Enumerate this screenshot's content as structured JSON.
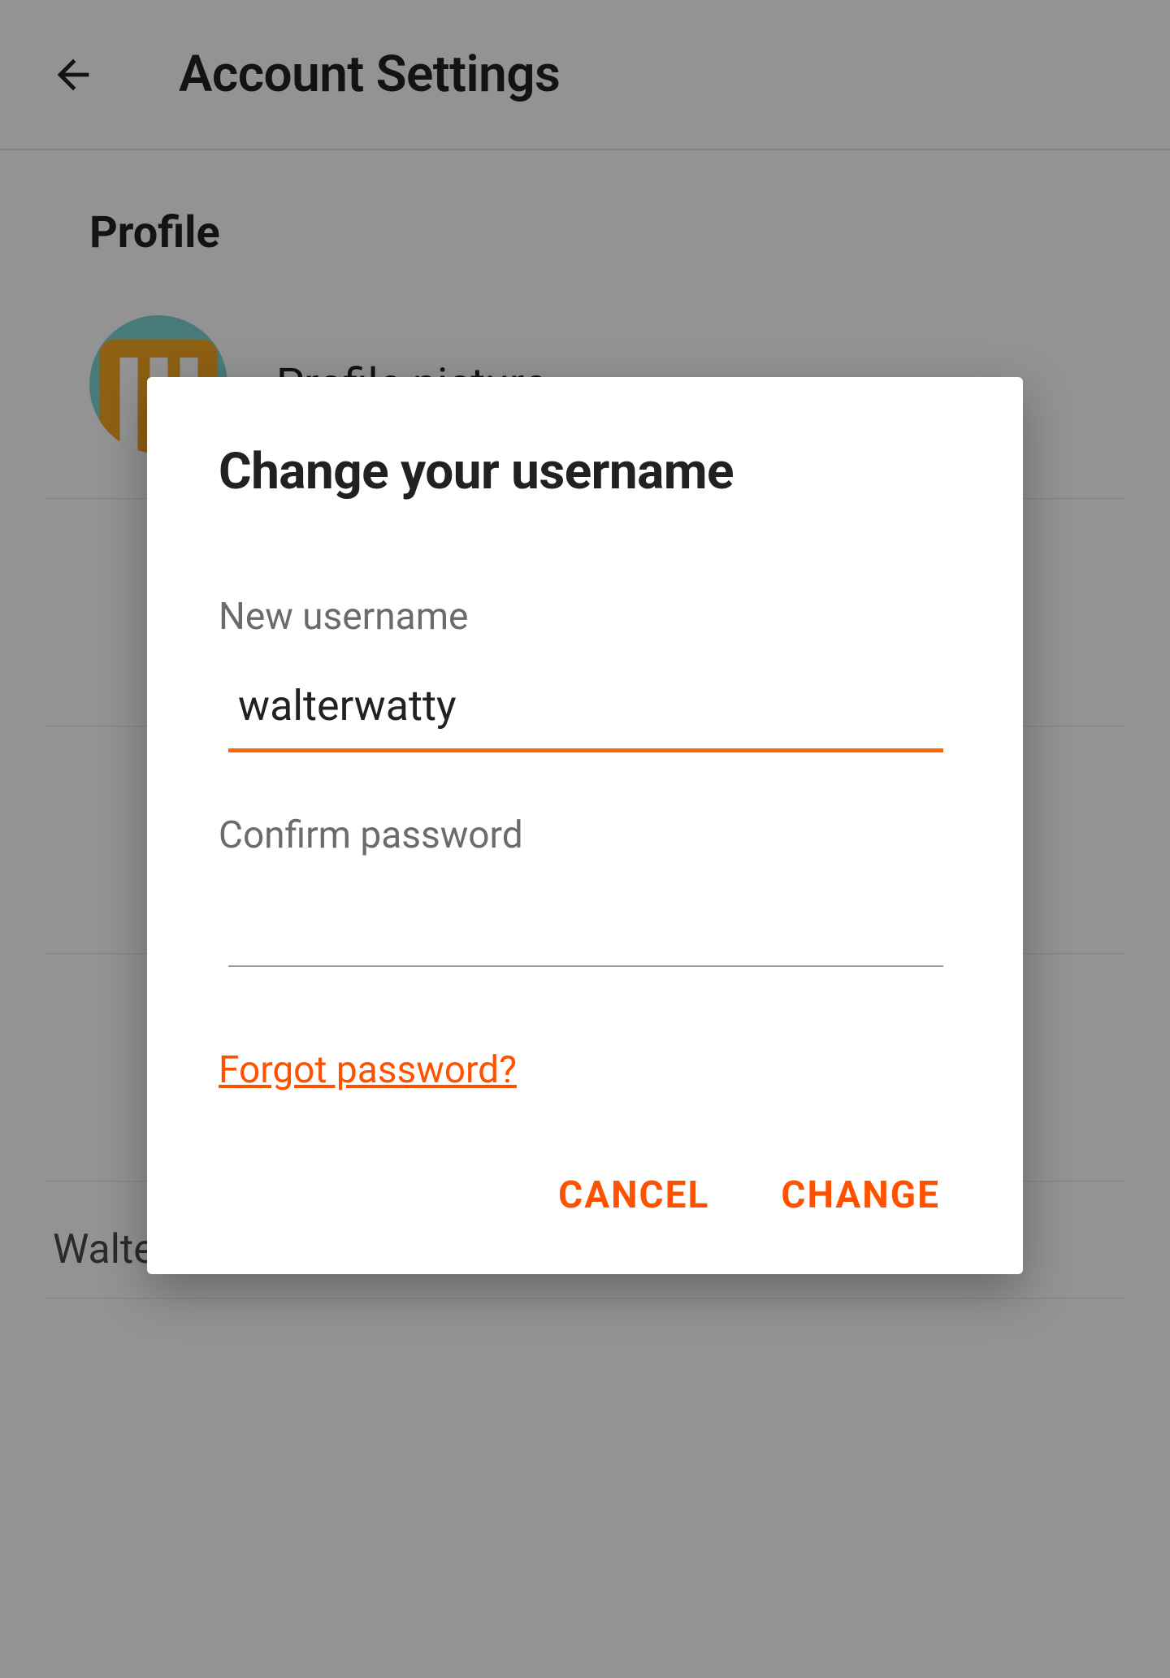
{
  "header": {
    "title": "Account Settings"
  },
  "profile": {
    "section_title": "Profile",
    "picture_label": "Profile picture",
    "name_value": "Walter Watty"
  },
  "dialog": {
    "title": "Change your username",
    "username_label": "New username",
    "username_value": "walterwatty",
    "password_label": "Confirm password",
    "password_value": "",
    "forgot_link": "Forgot password?",
    "cancel_label": "CANCEL",
    "change_label": "CHANGE"
  },
  "colors": {
    "accent": "#ff5200",
    "underline": "#ff6600"
  }
}
